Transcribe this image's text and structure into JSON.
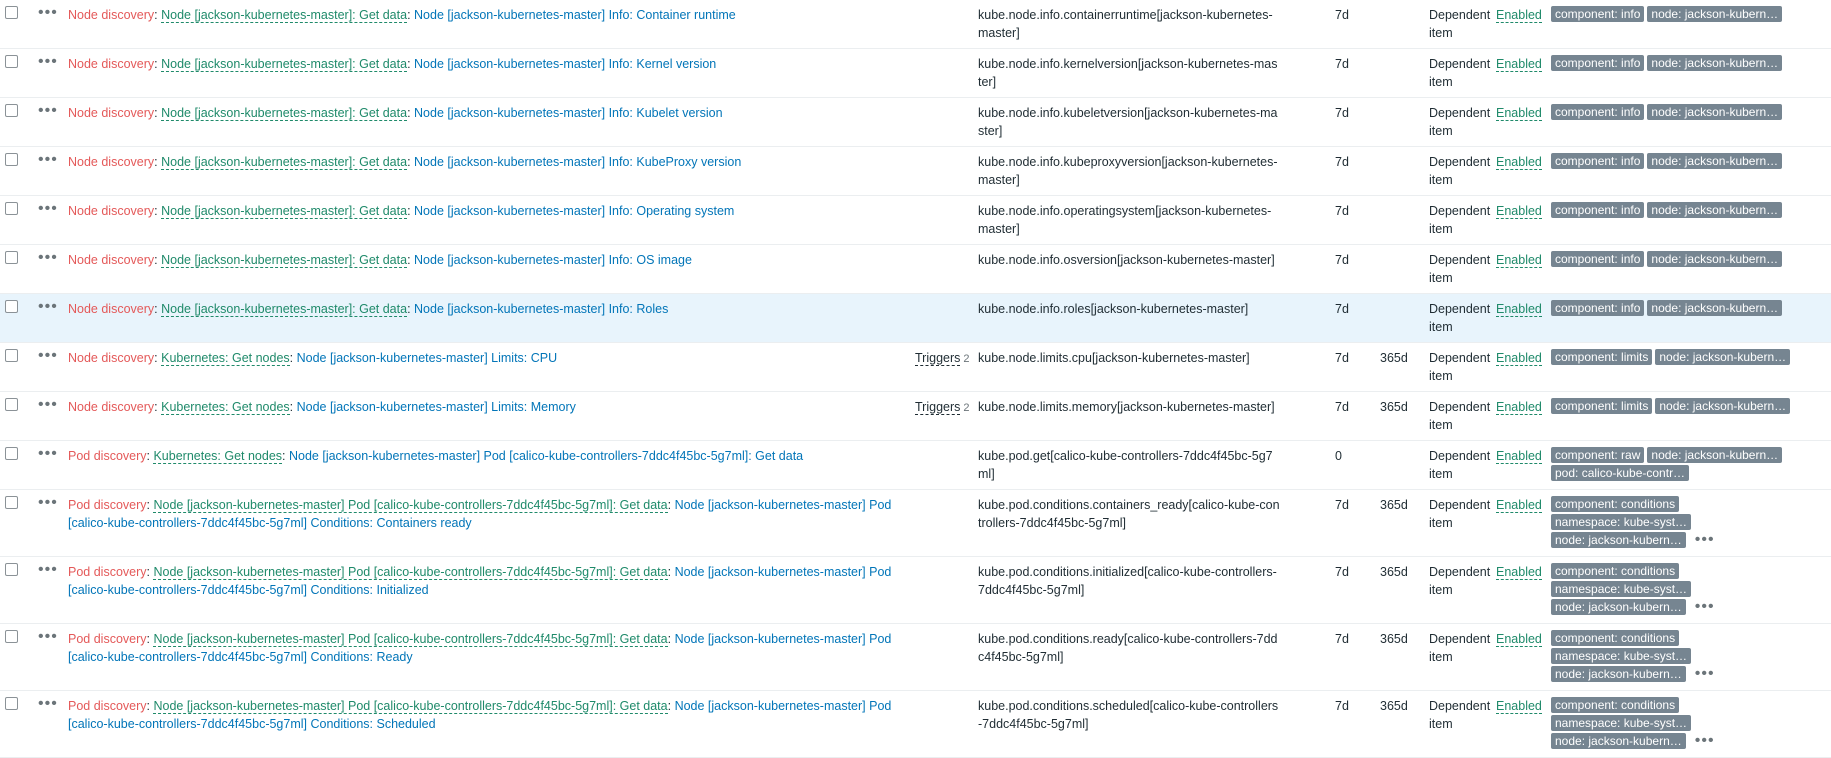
{
  "rows": [
    {
      "p1": "Node discovery",
      "p2": "Node [jackson-kubernetes-master]: Get data",
      "p3": "Node [jackson-kubernetes-master] Info: Container runtime",
      "triggers": "",
      "tcount": "",
      "key": "kube.node.info.containerruntime[jackson-kubernetes-master]",
      "history": "7d",
      "trends": "",
      "type": "Dependent item",
      "status": "Enabled",
      "tags": [
        "component: info",
        "node: jackson-kubern…"
      ],
      "more": false,
      "h": 49,
      "hl": false
    },
    {
      "p1": "Node discovery",
      "p2": "Node [jackson-kubernetes-master]: Get data",
      "p3": "Node [jackson-kubernetes-master] Info: Kernel version",
      "triggers": "",
      "tcount": "",
      "key": "kube.node.info.kernelversion[jackson-kubernetes-master]",
      "history": "7d",
      "trends": "",
      "type": "Dependent item",
      "status": "Enabled",
      "tags": [
        "component: info",
        "node: jackson-kubern…"
      ],
      "more": false,
      "h": 49,
      "hl": false
    },
    {
      "p1": "Node discovery",
      "p2": "Node [jackson-kubernetes-master]: Get data",
      "p3": "Node [jackson-kubernetes-master] Info: Kubelet version",
      "triggers": "",
      "tcount": "",
      "key": "kube.node.info.kubeletversion[jackson-kubernetes-master]",
      "history": "7d",
      "trends": "",
      "type": "Dependent item",
      "status": "Enabled",
      "tags": [
        "component: info",
        "node: jackson-kubern…"
      ],
      "more": false,
      "h": 49,
      "hl": false
    },
    {
      "p1": "Node discovery",
      "p2": "Node [jackson-kubernetes-master]: Get data",
      "p3": "Node [jackson-kubernetes-master] Info: KubeProxy version",
      "triggers": "",
      "tcount": "",
      "key": "kube.node.info.kubeproxyversion[jackson-kubernetes-master]",
      "history": "7d",
      "trends": "",
      "type": "Dependent item",
      "status": "Enabled",
      "tags": [
        "component: info",
        "node: jackson-kubern…"
      ],
      "more": false,
      "h": 49,
      "hl": false
    },
    {
      "p1": "Node discovery",
      "p2": "Node [jackson-kubernetes-master]: Get data",
      "p3": "Node [jackson-kubernetes-master] Info: Operating system",
      "triggers": "",
      "tcount": "",
      "key": "kube.node.info.operatingsystem[jackson-kubernetes-master]",
      "history": "7d",
      "trends": "",
      "type": "Dependent item",
      "status": "Enabled",
      "tags": [
        "component: info",
        "node: jackson-kubern…"
      ],
      "more": false,
      "h": 49,
      "hl": false
    },
    {
      "p1": "Node discovery",
      "p2": "Node [jackson-kubernetes-master]: Get data",
      "p3": "Node [jackson-kubernetes-master] Info: OS image",
      "triggers": "",
      "tcount": "",
      "key": "kube.node.info.osversion[jackson-kubernetes-master]",
      "history": "7d",
      "trends": "",
      "type": "Dependent item",
      "status": "Enabled",
      "tags": [
        "component: info",
        "node: jackson-kubern…"
      ],
      "more": false,
      "h": 49,
      "hl": false
    },
    {
      "p1": "Node discovery",
      "p2": "Node [jackson-kubernetes-master]: Get data",
      "p3": "Node [jackson-kubernetes-master] Info: Roles",
      "triggers": "",
      "tcount": "",
      "key": "kube.node.info.roles[jackson-kubernetes-master]",
      "history": "7d",
      "trends": "",
      "type": "Dependent item",
      "status": "Enabled",
      "tags": [
        "component: info",
        "node: jackson-kubern…"
      ],
      "more": false,
      "h": 49,
      "hl": true
    },
    {
      "p1": "Node discovery",
      "p2": "Kubernetes: Get nodes",
      "p3": "Node [jackson-kubernetes-master] Limits: CPU",
      "triggers": "Triggers",
      "tcount": "2",
      "key": "kube.node.limits.cpu[jackson-kubernetes-master]",
      "history": "7d",
      "trends": "365d",
      "type": "Dependent item",
      "status": "Enabled",
      "tags": [
        "component: limits",
        "node: jackson-kubern…"
      ],
      "more": false,
      "h": 49,
      "hl": false
    },
    {
      "p1": "Node discovery",
      "p2": "Kubernetes: Get nodes",
      "p3": "Node [jackson-kubernetes-master] Limits: Memory",
      "triggers": "Triggers",
      "tcount": "2",
      "key": "kube.node.limits.memory[jackson-kubernetes-master]",
      "history": "7d",
      "trends": "365d",
      "type": "Dependent item",
      "status": "Enabled",
      "tags": [
        "component: limits",
        "node: jackson-kubern…"
      ],
      "more": false,
      "h": 49,
      "hl": false
    },
    {
      "p1": "Pod discovery",
      "p2": "Kubernetes: Get nodes",
      "p3": "Node [jackson-kubernetes-master] Pod [calico-kube-controllers-7ddc4f45bc-5g7ml]: Get data",
      "triggers": "",
      "tcount": "",
      "key": "kube.pod.get[calico-kube-controllers-7ddc4f45bc-5g7ml]",
      "history": "0",
      "trends": "",
      "type": "Dependent item",
      "status": "Enabled",
      "tags": [
        "component: raw",
        "node: jackson-kubern…",
        "pod: calico-kube-contr…"
      ],
      "more": false,
      "h": 49,
      "hl": false
    },
    {
      "p1": "Pod discovery",
      "p2": "Node [jackson-kubernetes-master] Pod [calico-kube-controllers-7ddc4f45bc-5g7ml]: Get data",
      "p3": "Node [jackson-kubernetes-master] Pod [calico-kube-controllers-7ddc4f45bc-5g7ml] Conditions: Containers ready",
      "triggers": "",
      "tcount": "",
      "key": "kube.pod.conditions.containers_ready[calico-kube-controllers-7ddc4f45bc-5g7ml]",
      "history": "7d",
      "trends": "365d",
      "type": "Dependent item",
      "status": "Enabled",
      "tags": [
        "component: conditions",
        "namespace: kube-syst…",
        "node: jackson-kubern…"
      ],
      "more": true,
      "h": 67,
      "hl": false
    },
    {
      "p1": "Pod discovery",
      "p2": "Node [jackson-kubernetes-master] Pod [calico-kube-controllers-7ddc4f45bc-5g7ml]: Get data",
      "p3": "Node [jackson-kubernetes-master] Pod [calico-kube-controllers-7ddc4f45bc-5g7ml] Conditions: Initialized",
      "triggers": "",
      "tcount": "",
      "key": "kube.pod.conditions.initialized[calico-kube-controllers-7ddc4f45bc-5g7ml]",
      "history": "7d",
      "trends": "365d",
      "type": "Dependent item",
      "status": "Enabled",
      "tags": [
        "component: conditions",
        "namespace: kube-syst…",
        "node: jackson-kubern…"
      ],
      "more": true,
      "h": 67,
      "hl": false
    },
    {
      "p1": "Pod discovery",
      "p2": "Node [jackson-kubernetes-master] Pod [calico-kube-controllers-7ddc4f45bc-5g7ml]: Get data",
      "p3": "Node [jackson-kubernetes-master] Pod [calico-kube-controllers-7ddc4f45bc-5g7ml] Conditions: Ready",
      "triggers": "",
      "tcount": "",
      "key": "kube.pod.conditions.ready[calico-kube-controllers-7ddc4f45bc-5g7ml]",
      "history": "7d",
      "trends": "365d",
      "type": "Dependent item",
      "status": "Enabled",
      "tags": [
        "component: conditions",
        "namespace: kube-syst…",
        "node: jackson-kubern…"
      ],
      "more": true,
      "h": 67,
      "hl": false
    },
    {
      "p1": "Pod discovery",
      "p2": "Node [jackson-kubernetes-master] Pod [calico-kube-controllers-7ddc4f45bc-5g7ml]: Get data",
      "p3": "Node [jackson-kubernetes-master] Pod [calico-kube-controllers-7ddc4f45bc-5g7ml] Conditions: Scheduled",
      "triggers": "",
      "tcount": "",
      "key": "kube.pod.conditions.scheduled[calico-kube-controllers-7ddc4f45bc-5g7ml]",
      "history": "7d",
      "trends": "365d",
      "type": "Dependent item",
      "status": "Enabled",
      "tags": [
        "component: conditions",
        "namespace: kube-syst…",
        "node: jackson-kubern…"
      ],
      "more": true,
      "h": 67,
      "hl": false
    }
  ]
}
